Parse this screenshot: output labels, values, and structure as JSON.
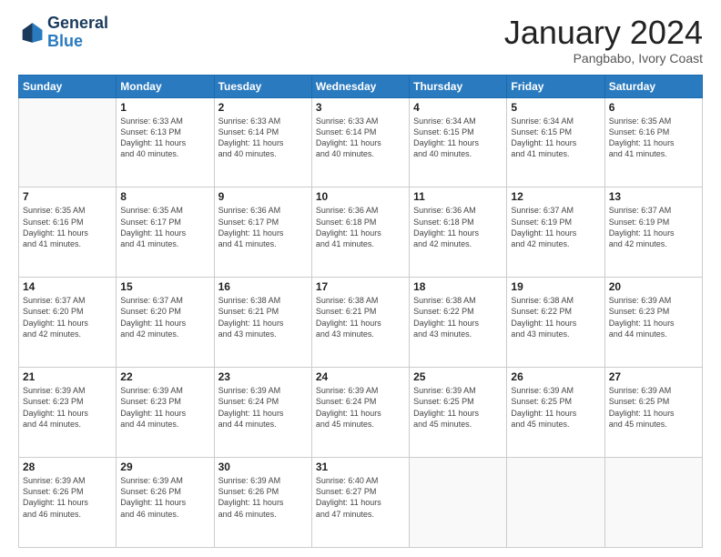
{
  "logo": {
    "line1": "General",
    "line2": "Blue"
  },
  "title": "January 2024",
  "subtitle": "Pangbabo, Ivory Coast",
  "days_of_week": [
    "Sunday",
    "Monday",
    "Tuesday",
    "Wednesday",
    "Thursday",
    "Friday",
    "Saturday"
  ],
  "weeks": [
    [
      {
        "day": "",
        "info": ""
      },
      {
        "day": "1",
        "info": "Sunrise: 6:33 AM\nSunset: 6:13 PM\nDaylight: 11 hours\nand 40 minutes."
      },
      {
        "day": "2",
        "info": "Sunrise: 6:33 AM\nSunset: 6:14 PM\nDaylight: 11 hours\nand 40 minutes."
      },
      {
        "day": "3",
        "info": "Sunrise: 6:33 AM\nSunset: 6:14 PM\nDaylight: 11 hours\nand 40 minutes."
      },
      {
        "day": "4",
        "info": "Sunrise: 6:34 AM\nSunset: 6:15 PM\nDaylight: 11 hours\nand 40 minutes."
      },
      {
        "day": "5",
        "info": "Sunrise: 6:34 AM\nSunset: 6:15 PM\nDaylight: 11 hours\nand 41 minutes."
      },
      {
        "day": "6",
        "info": "Sunrise: 6:35 AM\nSunset: 6:16 PM\nDaylight: 11 hours\nand 41 minutes."
      }
    ],
    [
      {
        "day": "7",
        "info": "Sunrise: 6:35 AM\nSunset: 6:16 PM\nDaylight: 11 hours\nand 41 minutes."
      },
      {
        "day": "8",
        "info": "Sunrise: 6:35 AM\nSunset: 6:17 PM\nDaylight: 11 hours\nand 41 minutes."
      },
      {
        "day": "9",
        "info": "Sunrise: 6:36 AM\nSunset: 6:17 PM\nDaylight: 11 hours\nand 41 minutes."
      },
      {
        "day": "10",
        "info": "Sunrise: 6:36 AM\nSunset: 6:18 PM\nDaylight: 11 hours\nand 41 minutes."
      },
      {
        "day": "11",
        "info": "Sunrise: 6:36 AM\nSunset: 6:18 PM\nDaylight: 11 hours\nand 42 minutes."
      },
      {
        "day": "12",
        "info": "Sunrise: 6:37 AM\nSunset: 6:19 PM\nDaylight: 11 hours\nand 42 minutes."
      },
      {
        "day": "13",
        "info": "Sunrise: 6:37 AM\nSunset: 6:19 PM\nDaylight: 11 hours\nand 42 minutes."
      }
    ],
    [
      {
        "day": "14",
        "info": "Sunrise: 6:37 AM\nSunset: 6:20 PM\nDaylight: 11 hours\nand 42 minutes."
      },
      {
        "day": "15",
        "info": "Sunrise: 6:37 AM\nSunset: 6:20 PM\nDaylight: 11 hours\nand 42 minutes."
      },
      {
        "day": "16",
        "info": "Sunrise: 6:38 AM\nSunset: 6:21 PM\nDaylight: 11 hours\nand 43 minutes."
      },
      {
        "day": "17",
        "info": "Sunrise: 6:38 AM\nSunset: 6:21 PM\nDaylight: 11 hours\nand 43 minutes."
      },
      {
        "day": "18",
        "info": "Sunrise: 6:38 AM\nSunset: 6:22 PM\nDaylight: 11 hours\nand 43 minutes."
      },
      {
        "day": "19",
        "info": "Sunrise: 6:38 AM\nSunset: 6:22 PM\nDaylight: 11 hours\nand 43 minutes."
      },
      {
        "day": "20",
        "info": "Sunrise: 6:39 AM\nSunset: 6:23 PM\nDaylight: 11 hours\nand 44 minutes."
      }
    ],
    [
      {
        "day": "21",
        "info": "Sunrise: 6:39 AM\nSunset: 6:23 PM\nDaylight: 11 hours\nand 44 minutes."
      },
      {
        "day": "22",
        "info": "Sunrise: 6:39 AM\nSunset: 6:23 PM\nDaylight: 11 hours\nand 44 minutes."
      },
      {
        "day": "23",
        "info": "Sunrise: 6:39 AM\nSunset: 6:24 PM\nDaylight: 11 hours\nand 44 minutes."
      },
      {
        "day": "24",
        "info": "Sunrise: 6:39 AM\nSunset: 6:24 PM\nDaylight: 11 hours\nand 45 minutes."
      },
      {
        "day": "25",
        "info": "Sunrise: 6:39 AM\nSunset: 6:25 PM\nDaylight: 11 hours\nand 45 minutes."
      },
      {
        "day": "26",
        "info": "Sunrise: 6:39 AM\nSunset: 6:25 PM\nDaylight: 11 hours\nand 45 minutes."
      },
      {
        "day": "27",
        "info": "Sunrise: 6:39 AM\nSunset: 6:25 PM\nDaylight: 11 hours\nand 45 minutes."
      }
    ],
    [
      {
        "day": "28",
        "info": "Sunrise: 6:39 AM\nSunset: 6:26 PM\nDaylight: 11 hours\nand 46 minutes."
      },
      {
        "day": "29",
        "info": "Sunrise: 6:39 AM\nSunset: 6:26 PM\nDaylight: 11 hours\nand 46 minutes."
      },
      {
        "day": "30",
        "info": "Sunrise: 6:39 AM\nSunset: 6:26 PM\nDaylight: 11 hours\nand 46 minutes."
      },
      {
        "day": "31",
        "info": "Sunrise: 6:40 AM\nSunset: 6:27 PM\nDaylight: 11 hours\nand 47 minutes."
      },
      {
        "day": "",
        "info": ""
      },
      {
        "day": "",
        "info": ""
      },
      {
        "day": "",
        "info": ""
      }
    ]
  ]
}
